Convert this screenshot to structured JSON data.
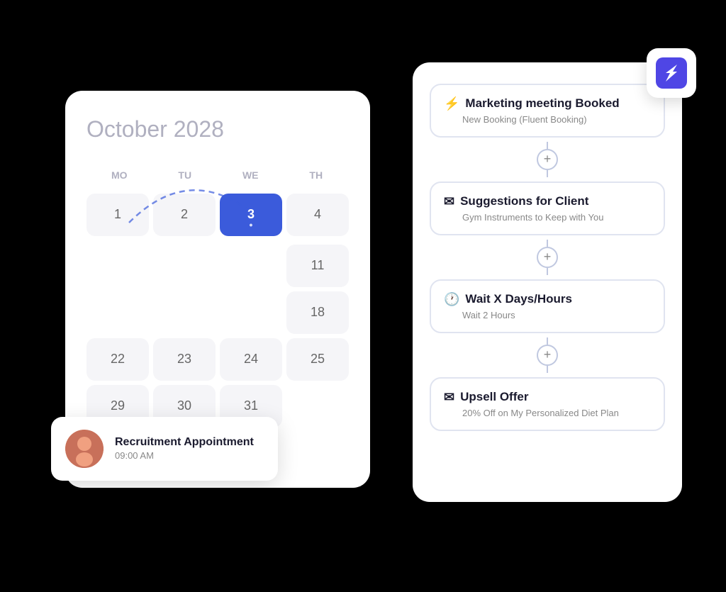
{
  "calendar": {
    "month": "October",
    "year": "2028",
    "headers": [
      "MO",
      "TU",
      "WE",
      "TH"
    ],
    "weeks": [
      [
        {
          "num": "1",
          "state": "normal"
        },
        {
          "num": "2",
          "state": "normal"
        },
        {
          "num": "3",
          "state": "active"
        },
        {
          "num": "4",
          "state": "normal"
        }
      ],
      [
        {
          "num": "",
          "state": "empty"
        },
        {
          "num": "",
          "state": "empty"
        },
        {
          "num": "",
          "state": "empty"
        },
        {
          "num": "11",
          "state": "normal"
        }
      ],
      [
        {
          "num": "",
          "state": "empty"
        },
        {
          "num": "",
          "state": "empty"
        },
        {
          "num": "",
          "state": "empty"
        },
        {
          "num": "18",
          "state": "normal"
        }
      ],
      [
        {
          "num": "22",
          "state": "normal"
        },
        {
          "num": "23",
          "state": "normal"
        },
        {
          "num": "24",
          "state": "normal"
        },
        {
          "num": "25",
          "state": "normal"
        }
      ],
      [
        {
          "num": "29",
          "state": "normal"
        },
        {
          "num": "30",
          "state": "normal"
        },
        {
          "num": "31",
          "state": "normal"
        },
        {
          "num": "",
          "state": "empty"
        }
      ]
    ]
  },
  "appointment": {
    "title": "Recruitment Appointment",
    "time": "09:00 AM",
    "avatar_emoji": "👩"
  },
  "workflow": {
    "steps": [
      {
        "icon": "⚡",
        "title": "Marketing meeting Booked",
        "subtitle": "New Booking (Fluent Booking)"
      },
      {
        "icon": "✉",
        "title": "Suggestions for Client",
        "subtitle": "Gym Instruments to Keep with You"
      },
      {
        "icon": "🕐",
        "title": "Wait X Days/Hours",
        "subtitle": "Wait 2 Hours"
      },
      {
        "icon": "✉",
        "title": "Upsell Offer",
        "subtitle": "20% Off on My Personalized Diet Plan"
      }
    ],
    "connector_label": "+"
  },
  "brand": {
    "name": "Fluent"
  }
}
